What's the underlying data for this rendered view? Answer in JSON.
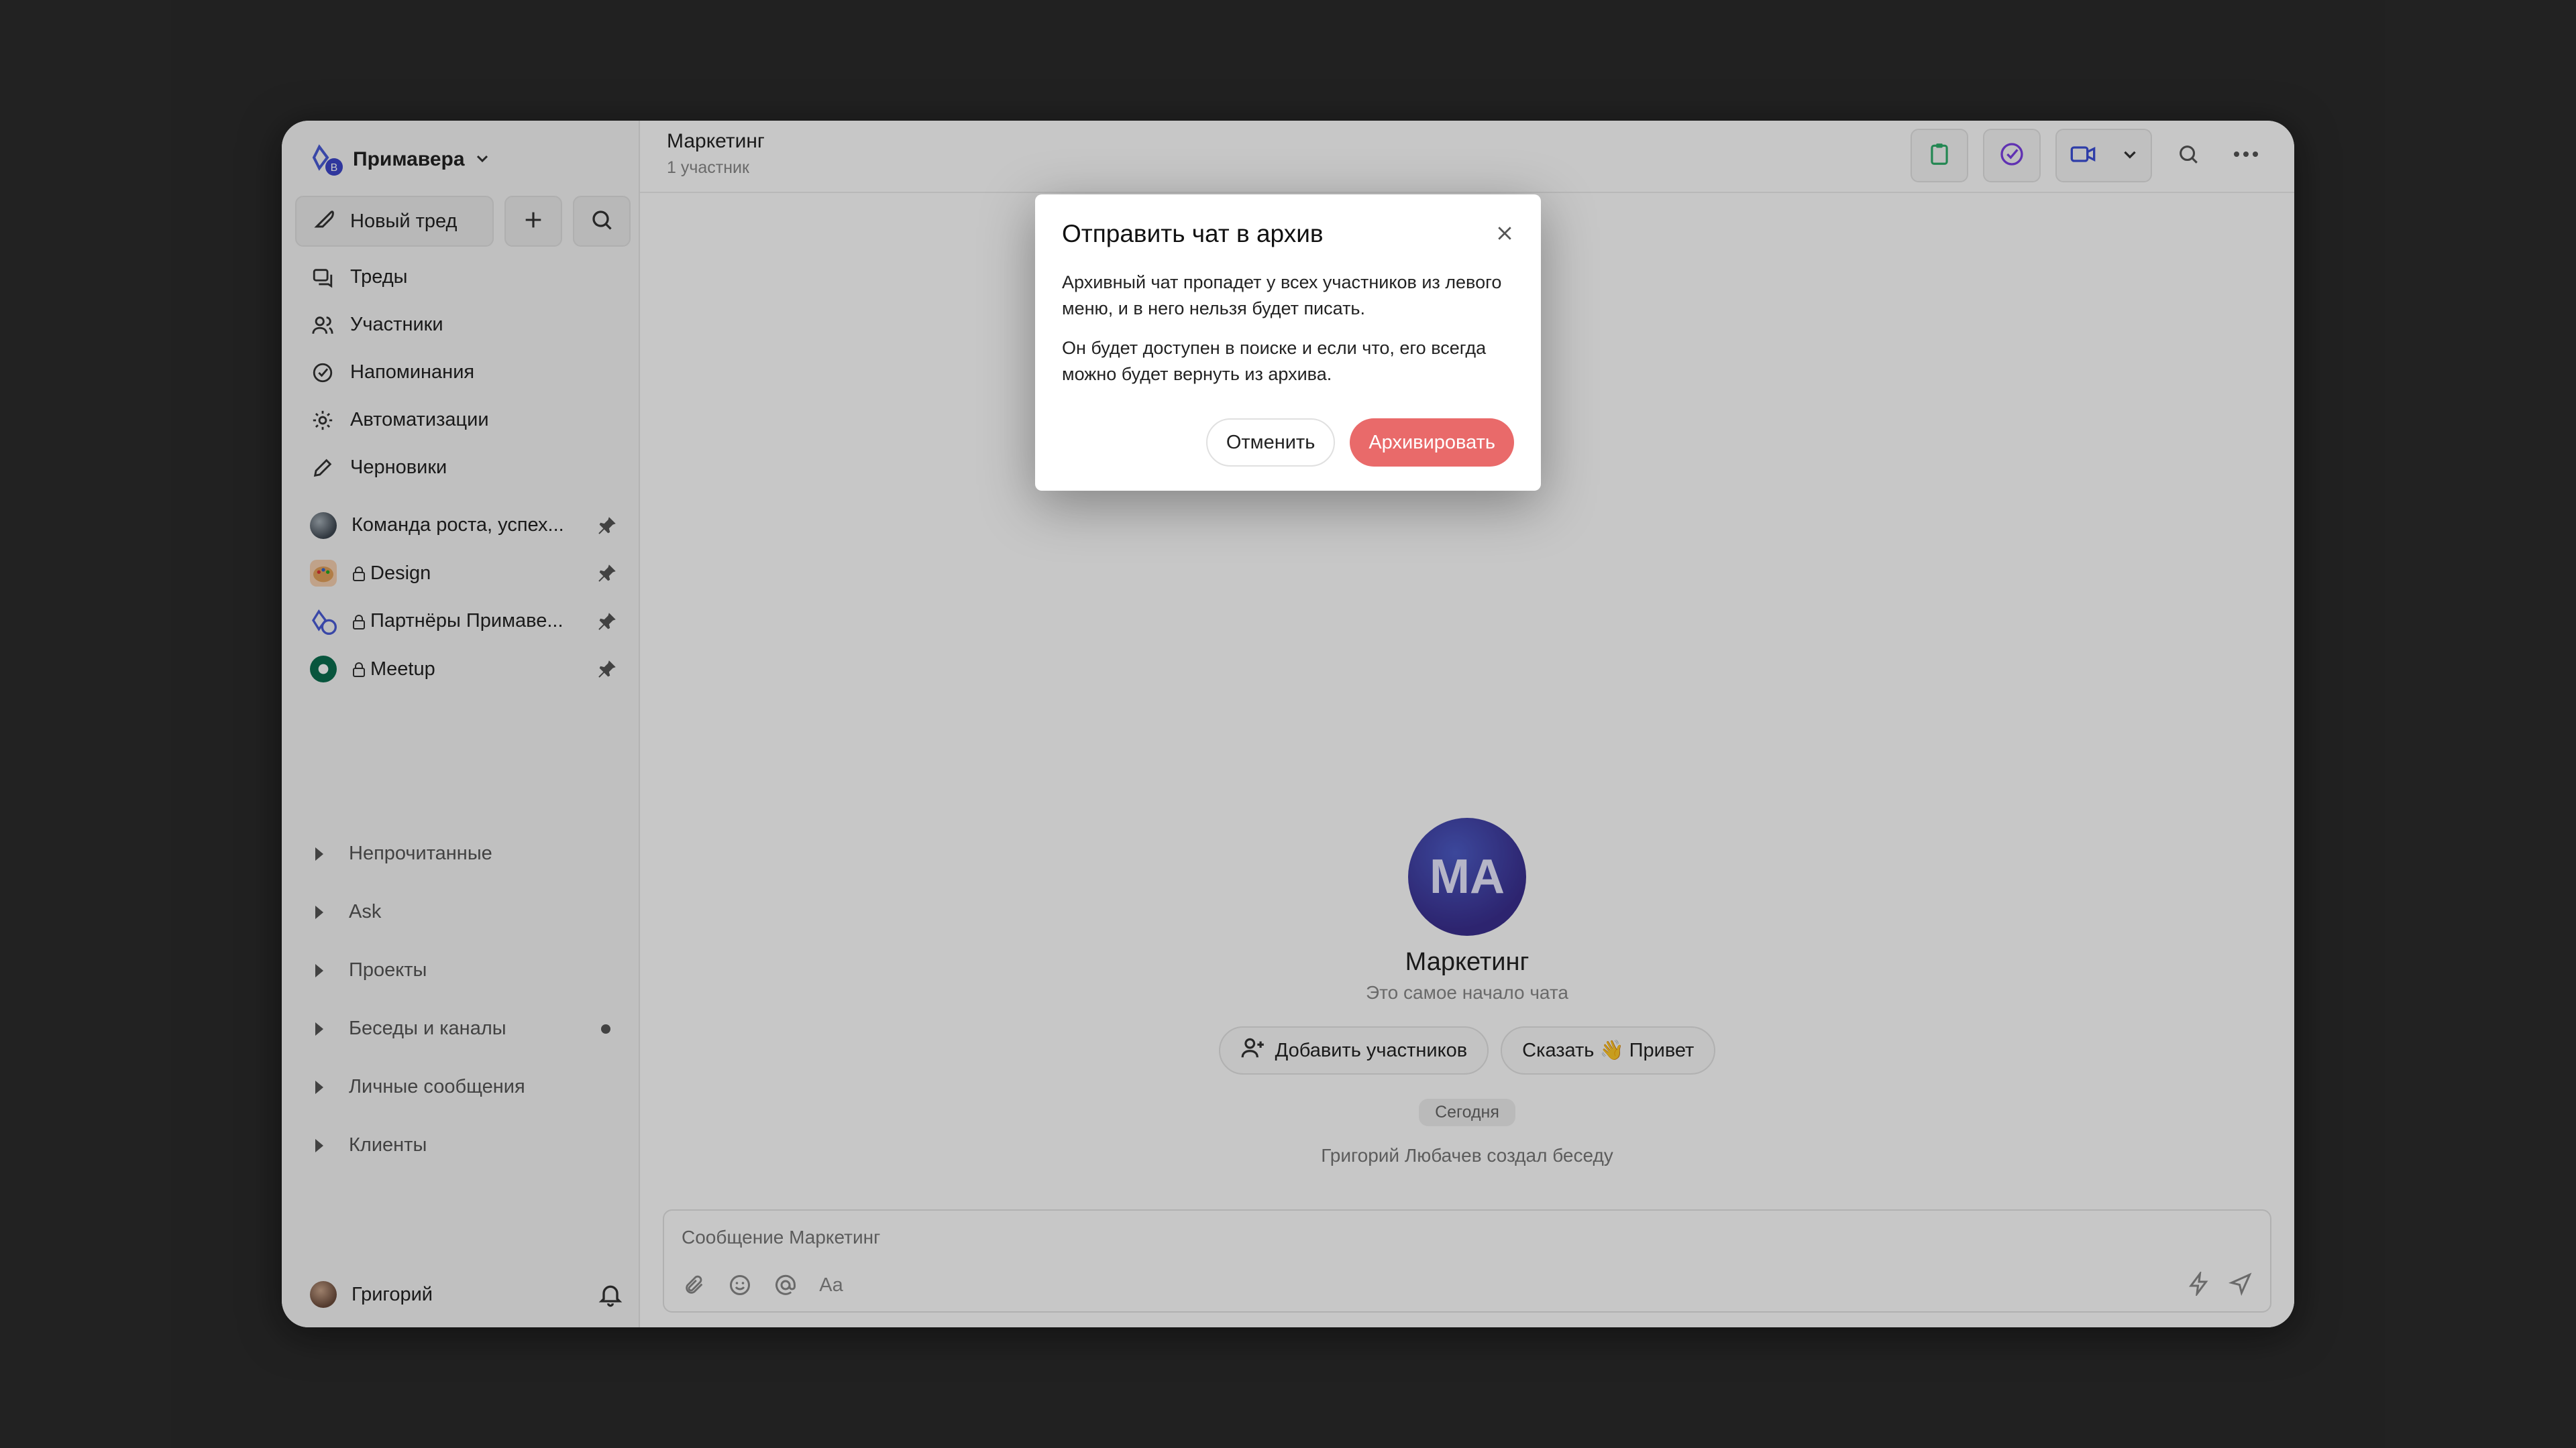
{
  "workspace": {
    "name": "Примавера",
    "avatar_badge": "B"
  },
  "sidebar": {
    "new_thread_label": "Новый тред",
    "nav": [
      {
        "label": "Треды",
        "icon": "threads-icon"
      },
      {
        "label": "Участники",
        "icon": "users-icon"
      },
      {
        "label": "Напоминания",
        "icon": "check-circle-icon"
      },
      {
        "label": "Автоматизации",
        "icon": "gear-icon"
      },
      {
        "label": "Черновики",
        "icon": "pencil-icon"
      }
    ],
    "chats": [
      {
        "name": "Команда роста, успех...",
        "locked": false
      },
      {
        "name": "Design",
        "locked": true
      },
      {
        "name": "Партнёры Примаве...",
        "locked": true
      },
      {
        "name": "Meetup",
        "locked": true
      }
    ],
    "groups": [
      {
        "label": "Непрочитанные",
        "dot": false
      },
      {
        "label": "Ask",
        "dot": false
      },
      {
        "label": "Проекты",
        "dot": false
      },
      {
        "label": "Беседы и каналы",
        "dot": true
      },
      {
        "label": "Личные сообщения",
        "dot": false
      },
      {
        "label": "Клиенты",
        "dot": false
      }
    ],
    "user_name": "Григорий"
  },
  "header": {
    "title": "Маркетинг",
    "subtitle": "1 участник"
  },
  "chat": {
    "avatar_initials": "MA",
    "title": "Маркетинг",
    "start_text": "Это самое начало чата",
    "add_members_label": "Добавить участников",
    "say_hi_label": "Сказать 👋 Привет",
    "date_chip": "Сегодня",
    "system_message": "Григорий Любачев создал беседу"
  },
  "composer": {
    "placeholder": "Сообщение Маркетинг",
    "format_label": "Aa"
  },
  "modal": {
    "title": "Отправить чат в архив",
    "paragraph1": "Архивный чат пропадет у всех участников из левого меню, и в него нельзя будет писать.",
    "paragraph2": "Он будет доступен в поиске и если что, его всегда можно будет вернуть из архива.",
    "cancel_label": "Отменить",
    "archive_label": "Архивировать"
  },
  "colors": {
    "archive_button": "#e96a6a",
    "avatar": "#3a2f8f",
    "background": "#2b2b2b"
  }
}
